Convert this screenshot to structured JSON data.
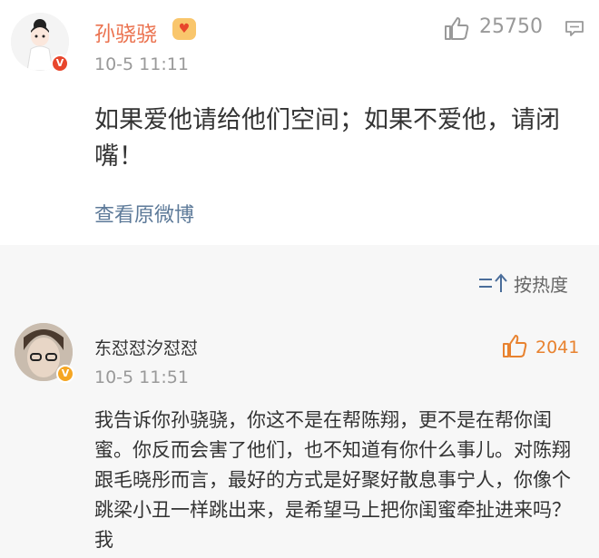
{
  "post": {
    "author": "孙骁骁",
    "time": "10-5 11:11",
    "likes": "25750",
    "text": "如果爱他请给他们空间；如果不爱他，请闭嘴！",
    "view_original": "查看原微博",
    "verified_badge": "V"
  },
  "sort": {
    "label": "按热度",
    "icon": "sort-icon"
  },
  "comment": {
    "author": "东怼怼汐怼怼",
    "time": "10-5 11:51",
    "likes": "2041",
    "text": "我告诉你孙骁骁，你这不是在帮陈翔，更不是在帮你闺蜜。你反而会害了他们，也不知道有你什么事儿。对陈翔跟毛晓彤而言，最好的方式是好聚好散息事宁人，你像个跳梁小丑一样跳出来，是希望马上把你闺蜜牵扯进来吗？我",
    "verified_badge": "V"
  },
  "colors": {
    "author_orange": "#eb7350",
    "link_blue": "#5d7a99",
    "like_orange": "#e8822f",
    "section_bg": "#f7f7f7"
  }
}
